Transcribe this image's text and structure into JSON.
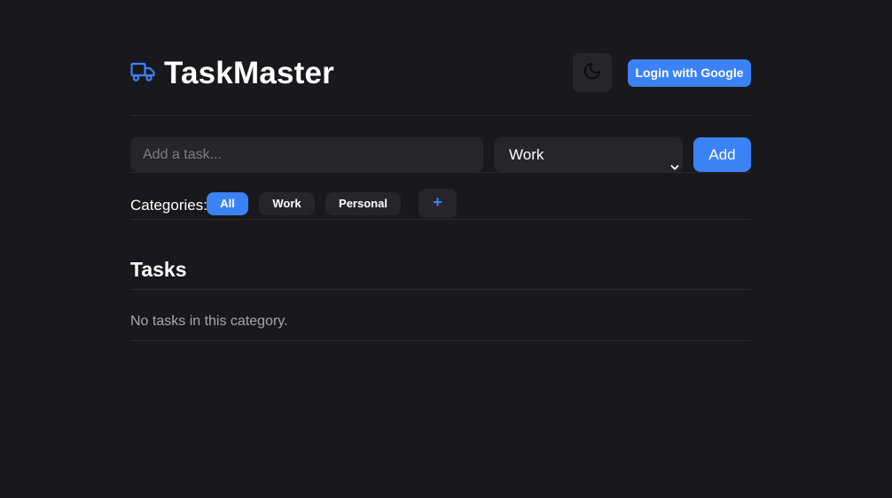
{
  "app": {
    "title": "TaskMaster",
    "logo_icon": "truck-icon",
    "theme_icon": "moon-icon",
    "login_label": "Login with Google"
  },
  "add_task": {
    "placeholder": "Add a task...",
    "selected_category": "Work",
    "add_label": "Add"
  },
  "categories": {
    "label": "Categories:",
    "items": [
      {
        "label": "All",
        "active": true
      },
      {
        "label": "Work",
        "active": false
      },
      {
        "label": "Personal",
        "active": false
      }
    ],
    "add_label": "+"
  },
  "tasks": {
    "heading": "Tasks",
    "empty_message": "No tasks in this category."
  },
  "colors": {
    "background": "#19191d",
    "surface": "#25252b",
    "accent": "#3b82f6",
    "divider": "#2a2a30",
    "muted_text": "#a6a6ad"
  }
}
